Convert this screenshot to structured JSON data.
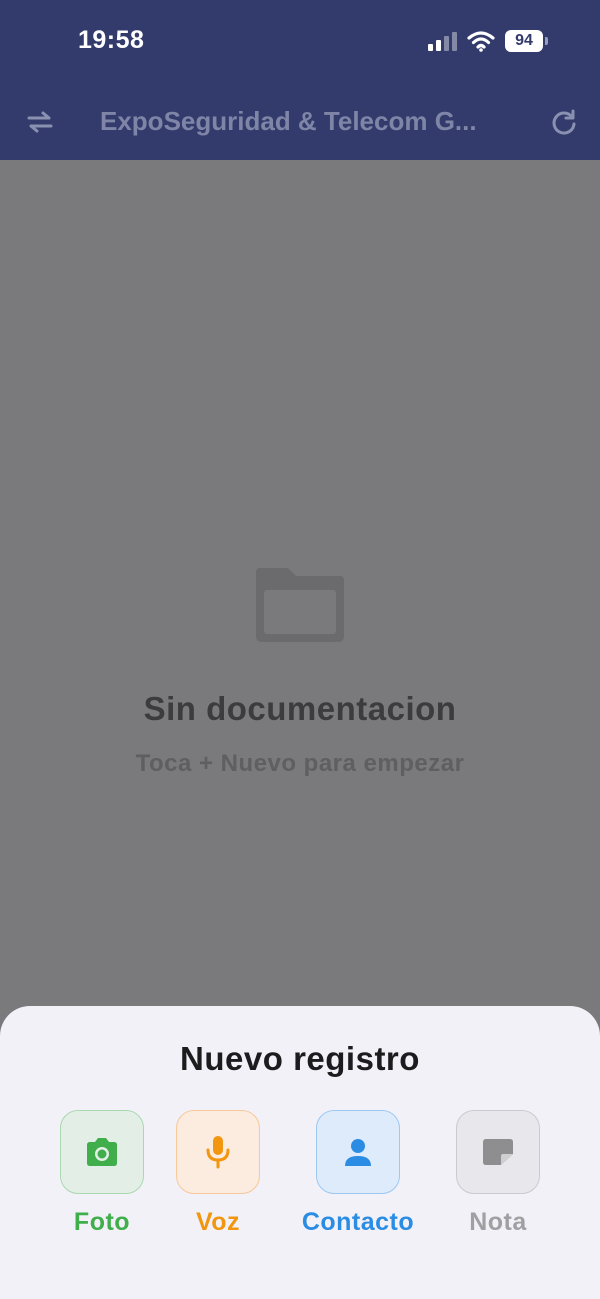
{
  "status_bar": {
    "time": "19:58",
    "battery": "94"
  },
  "nav": {
    "title": "ExpoSeguridad & Telecom G...",
    "left_icon": "swap-arrows-icon",
    "right_icon": "refresh-icon"
  },
  "empty_state": {
    "icon": "folder-icon",
    "title": "Sin documentacion",
    "subtitle": "Toca + Nuevo para empezar"
  },
  "sheet": {
    "title": "Nuevo registro",
    "actions": [
      {
        "label": "Foto",
        "icon": "camera-icon",
        "color": "#3fae4b"
      },
      {
        "label": "Voz",
        "icon": "microphone-icon",
        "color": "#f2960f"
      },
      {
        "label": "Contacto",
        "icon": "person-icon",
        "color": "#2b8ce4"
      },
      {
        "label": "Nota",
        "icon": "note-icon",
        "color": "#a0a0a3"
      }
    ]
  },
  "colors": {
    "nav_background": "#333b6c",
    "overlay": "#7a7a7c",
    "sheet_background": "#f3f1f8"
  }
}
